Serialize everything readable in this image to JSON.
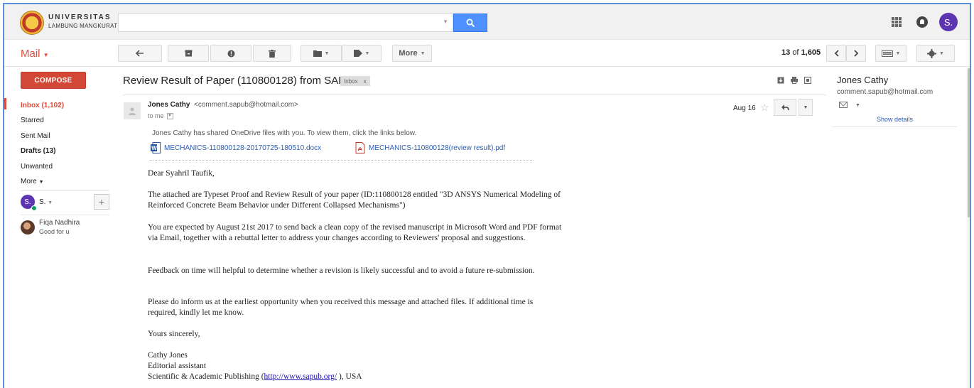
{
  "header": {
    "logo_line1": "UNIVERSITAS",
    "logo_line2": "LAMBUNG MANGKURAT",
    "search_placeholder": "",
    "account_initial": "S."
  },
  "toolbar": {
    "mail_label": "Mail",
    "more_label": "More",
    "pager_range": "13",
    "pager_of": "of",
    "pager_total": "1,605"
  },
  "sidebar": {
    "compose_label": "COMPOSE",
    "items": [
      {
        "label": "Inbox (1,102)"
      },
      {
        "label": "Starred"
      },
      {
        "label": "Sent Mail"
      },
      {
        "label": "Drafts (13)"
      },
      {
        "label": "Unwanted"
      },
      {
        "label": "More"
      }
    ],
    "chat_user": "S.",
    "contacts": [
      {
        "name": "Fiqa Nadhira",
        "status": "Good for u"
      }
    ]
  },
  "message": {
    "subject": "Review Result of Paper (110800128) from SAP",
    "label": "Inbox",
    "label_close": "x",
    "sender_name": "Jones Cathy",
    "sender_email": "<comment.sapub@hotmail.com>",
    "to": "to me",
    "date": "Aug 16",
    "share_note": "Jones Cathy has shared OneDrive files with you. To view them, click the links below.",
    "attachments": [
      {
        "name": "MECHANICS-110800128-20170725-180510.docx",
        "type": "docx"
      },
      {
        "name": "MECHANICS-110800128(review result).pdf",
        "type": "pdf"
      }
    ],
    "greeting": "Dear Syahril Taufik,",
    "para1": "The attached are Typeset Proof and Review Result of your paper (ID:110800128 entitled \"3D ANSYS Numerical Modeling of Reinforced Concrete Beam Behavior under Different Collapsed Mechanisms\")",
    "para2": "You are expected by August 21st 2017 to send back a clean copy of the revised manuscript in Microsoft Word and PDF format via Email, together with a rebuttal letter to address your changes according to Reviewers' proposal and suggestions.",
    "para3": "Feedback on time will helpful to determine whether a revision is likely successful and to avoid a future re-submission.",
    "para4": "Please do inform us at the earliest opportunity when you received this message and attached files. If additional time is required, kindly let me know.",
    "closing": "Yours sincerely,",
    "sig_name": "Cathy Jones",
    "sig_title": "Editorial assistant",
    "sig_org_prefix": "Scientific & Academic Publishing (",
    "sig_link": "http://www.sapub.org/",
    "sig_org_suffix": " ), USA"
  },
  "right_panel": {
    "name": "Jones Cathy",
    "email": "comment.sapub@hotmail.com",
    "show_details": "Show details"
  },
  "colors": {
    "accent_red": "#dd4b39",
    "compose_red": "#d14836",
    "search_blue": "#4d90fe",
    "link_blue": "#2a5db0",
    "avatar_purple": "#5e35b1"
  }
}
